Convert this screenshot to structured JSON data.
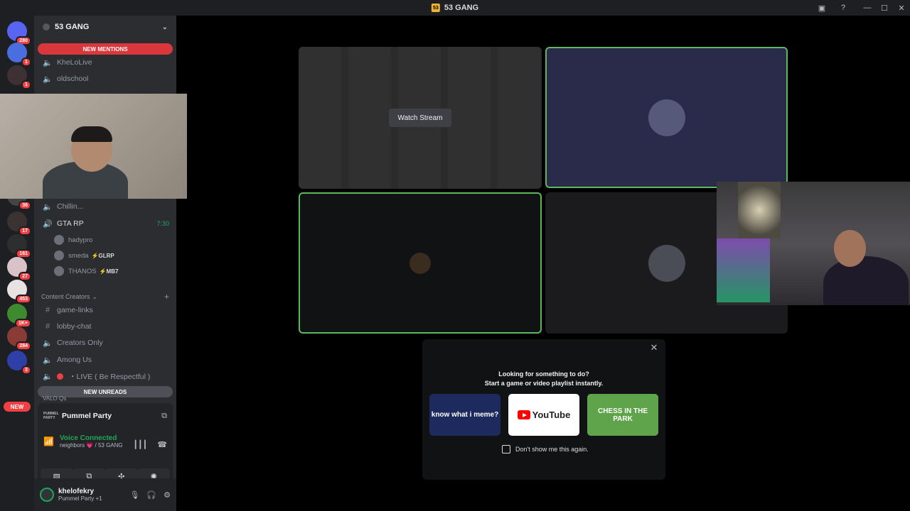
{
  "titlebar": {
    "server_badge": "53",
    "title": "53 GANG"
  },
  "rail": {
    "servers": [
      {
        "badge": "280"
      },
      {
        "badge": "1"
      },
      {
        "badge": "1"
      },
      {
        "badge": "36"
      },
      {
        "badge": "17"
      },
      {
        "badge": "161"
      },
      {
        "badge": "27"
      },
      {
        "badge": "453"
      },
      {
        "badge": "1K+"
      },
      {
        "badge": "284"
      },
      {
        "badge": "3"
      }
    ],
    "new_label": "NEW"
  },
  "sidebar": {
    "guild_name": "53 GANG",
    "new_mentions": "NEW MENTIONS",
    "channels_top": [
      {
        "name": "KheLoLive"
      },
      {
        "name": "oldschool"
      }
    ],
    "chillin": "Chillin...",
    "gta": {
      "name": "GTA RP",
      "timer": "7:30"
    },
    "voice_users": [
      {
        "name": "hadypro",
        "tag": ""
      },
      {
        "name": "smeda",
        "tag": "⚡GLRP"
      },
      {
        "name": "THANOS",
        "tag": "⚡MB7"
      }
    ],
    "category": "Content Creators",
    "channels": [
      {
        "name": "game-links"
      },
      {
        "name": "lobby-chat"
      },
      {
        "name": "Creators Only"
      },
      {
        "name": "Among Us"
      },
      {
        "name": "・LIVE ( Be Respectful )"
      }
    ],
    "new_unreads": "NEW UNREADS",
    "partial_channel": "VALO Qs"
  },
  "activity": {
    "logo": "PUMMEL PARTY",
    "name": "Pummel Party"
  },
  "voice": {
    "status": "Voice Connected",
    "location": "neighbors 💗 / 53 GANG"
  },
  "user": {
    "name": "khelofekry",
    "status": "Pummel Party +1"
  },
  "stage": {
    "watch_stream": "Watch Stream"
  },
  "popup": {
    "title_line1": "Looking for something to do?",
    "title_line2": "Start a game or video playlist instantly.",
    "cards": {
      "meme": "know what i meme?",
      "youtube": "YouTube",
      "chess": "CHESS IN THE PARK"
    },
    "dont_show": "Don't show me this again."
  },
  "colors": {
    "speaking_border": "#5eb75d",
    "mention_red": "#da373c",
    "voice_green": "#23a55a"
  }
}
